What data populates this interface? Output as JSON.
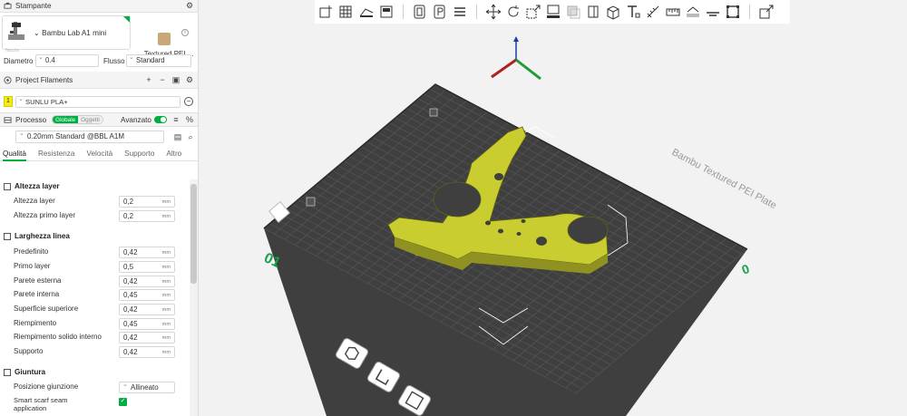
{
  "printer": {
    "section_title": "Stampante",
    "name": "Bambu Lab A1 mini",
    "small_label": "Nozzle",
    "plate_name": "Textured PEI ..."
  },
  "nozzle": {
    "diameter_label": "Diametro",
    "diameter_value": "0.4",
    "flow_label": "Flusso",
    "flow_value": "Standard"
  },
  "filaments": {
    "section_title": "Project Filaments",
    "items": [
      {
        "index": "1",
        "name": "SUNLU PLA+",
        "color": "#f2ee15"
      }
    ]
  },
  "process": {
    "section_title": "Processo",
    "mode_global": "Globale",
    "mode_objects": "Oggetti",
    "advanced_label": "Avanzato",
    "preset": "0.20mm Standard @BBL A1M",
    "tabs": [
      "Qualità",
      "Resistenza",
      "Velocità",
      "Supporto",
      "Altro"
    ],
    "active_tab": "Qualità"
  },
  "params": {
    "layer_height": {
      "title": "Altezza layer",
      "rows": [
        {
          "label": "Altezza layer",
          "value": "0,2",
          "unit": "mm"
        },
        {
          "label": "Altezza primo layer",
          "value": "0,2",
          "unit": "mm"
        }
      ]
    },
    "line_width": {
      "title": "Larghezza linea",
      "rows": [
        {
          "label": "Predefinito",
          "value": "0,42",
          "unit": "mm"
        },
        {
          "label": "Primo layer",
          "value": "0,5",
          "unit": "mm"
        },
        {
          "label": "Parete esterna",
          "value": "0,42",
          "unit": "mm"
        },
        {
          "label": "Parete interna",
          "value": "0,45",
          "unit": "mm"
        },
        {
          "label": "Superficie superiore",
          "value": "0,42",
          "unit": "mm"
        },
        {
          "label": "Riempimento",
          "value": "0,45",
          "unit": "mm"
        },
        {
          "label": "Riempimento solido interno",
          "value": "0,42",
          "unit": "mm"
        },
        {
          "label": "Supporto",
          "value": "0,42",
          "unit": "mm"
        }
      ]
    },
    "seam": {
      "title": "Giuntura",
      "position_label": "Posizione giunzione",
      "position_value": "Allineato",
      "scarf_label_1": "Smart scarf seam",
      "scarf_label_2": "application",
      "scarf_checked": true
    }
  },
  "viewport": {
    "bed_label": "Bambu Textured PEI Plate",
    "plate_number": "01",
    "plate_badge": "0"
  },
  "colors": {
    "accent": "#00ae42",
    "model": "#d2d63a",
    "bed": "#3f3f3f"
  }
}
